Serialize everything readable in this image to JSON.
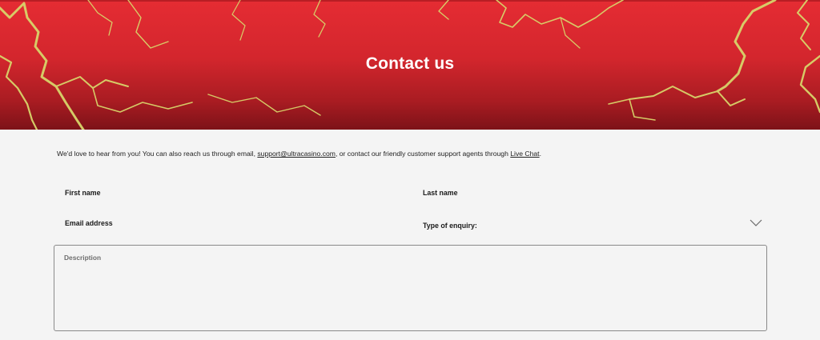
{
  "hero": {
    "title": "Contact us",
    "gradient_top": "#e52c33",
    "gradient_bottom": "#7d1218",
    "bolt_color": "#d8d46a"
  },
  "intro": {
    "text_before": "We'd love to hear from you! You can also reach us through email, ",
    "email_link": "support@ultracasino.com",
    "text_middle": ", or contact our friendly customer support agents through ",
    "chat_link": "Live Chat",
    "text_after": "."
  },
  "form": {
    "first_name_label": "First name",
    "last_name_label": "Last name",
    "email_label": "Email address",
    "enquiry_label": "Type of enquiry:",
    "enquiry_icon": "chevron-down-icon",
    "description_placeholder": "Description"
  }
}
